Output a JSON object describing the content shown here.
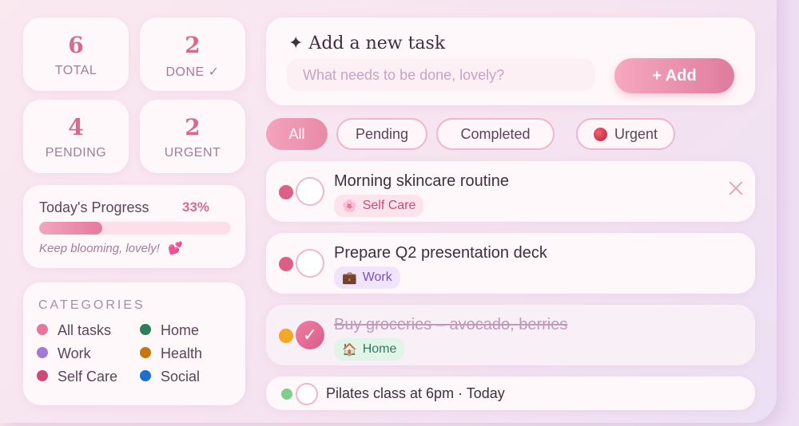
{
  "stats": [
    {
      "value": "6",
      "label": "TOTAL"
    },
    {
      "value": "2",
      "label": "DONE ✓"
    },
    {
      "value": "4",
      "label": "PENDING"
    },
    {
      "value": "2",
      "label": "URGENT"
    }
  ],
  "progress": {
    "title": "Today's Progress",
    "percent_label": "33%",
    "fraction": 0.33,
    "message": "Keep blooming, lovely!",
    "message_icon": "💕"
  },
  "categories": {
    "title": "CATEGORIES",
    "items": [
      {
        "label": "All tasks",
        "color": "#e6779a"
      },
      {
        "label": "Home",
        "color": "#2e7d5b"
      },
      {
        "label": "Work",
        "color": "#a07ad6"
      },
      {
        "label": "Health",
        "color": "#c87510"
      },
      {
        "label": "Self Care",
        "color": "#d04877"
      },
      {
        "label": "Social",
        "color": "#1c6fd1"
      }
    ]
  },
  "add_task": {
    "title": "✦ Add a new task",
    "placeholder": "What needs to be done, lovely?",
    "button_label": "+ Add"
  },
  "filters": [
    {
      "label": "All",
      "active": true
    },
    {
      "label": "Pending",
      "active": false
    },
    {
      "label": "Completed",
      "active": false
    },
    {
      "label": "Urgent",
      "active": false
    }
  ],
  "tasks": [
    {
      "title": "Morning skincare routine",
      "tag": "Self Care",
      "tag_icon": "🌸",
      "priority_color": "#de5f86",
      "done": false
    },
    {
      "title": "Prepare Q2 presentation deck",
      "tag": "Work",
      "tag_icon": "💼",
      "priority_color": "#de5f86",
      "done": false
    },
    {
      "title": "Buy groceries – avocado, berries",
      "tag": "Home",
      "tag_icon": "🏠",
      "priority_color": "#f5a623",
      "done": true,
      "check_glyph": "✓"
    },
    {
      "title": "Pilates class at 6pm · Today",
      "priority_color": "#7fcf8a",
      "done": false
    }
  ],
  "colors": {
    "accent": "#e07b9e",
    "self_care_tag_bg": "#fde3ec",
    "self_care_tag_text": "#d04877",
    "work_tag_bg": "#efe4fb",
    "work_tag_text": "#7a52b8",
    "home_tag_bg": "#e0f4e8",
    "home_tag_text": "#2e7d5b"
  }
}
